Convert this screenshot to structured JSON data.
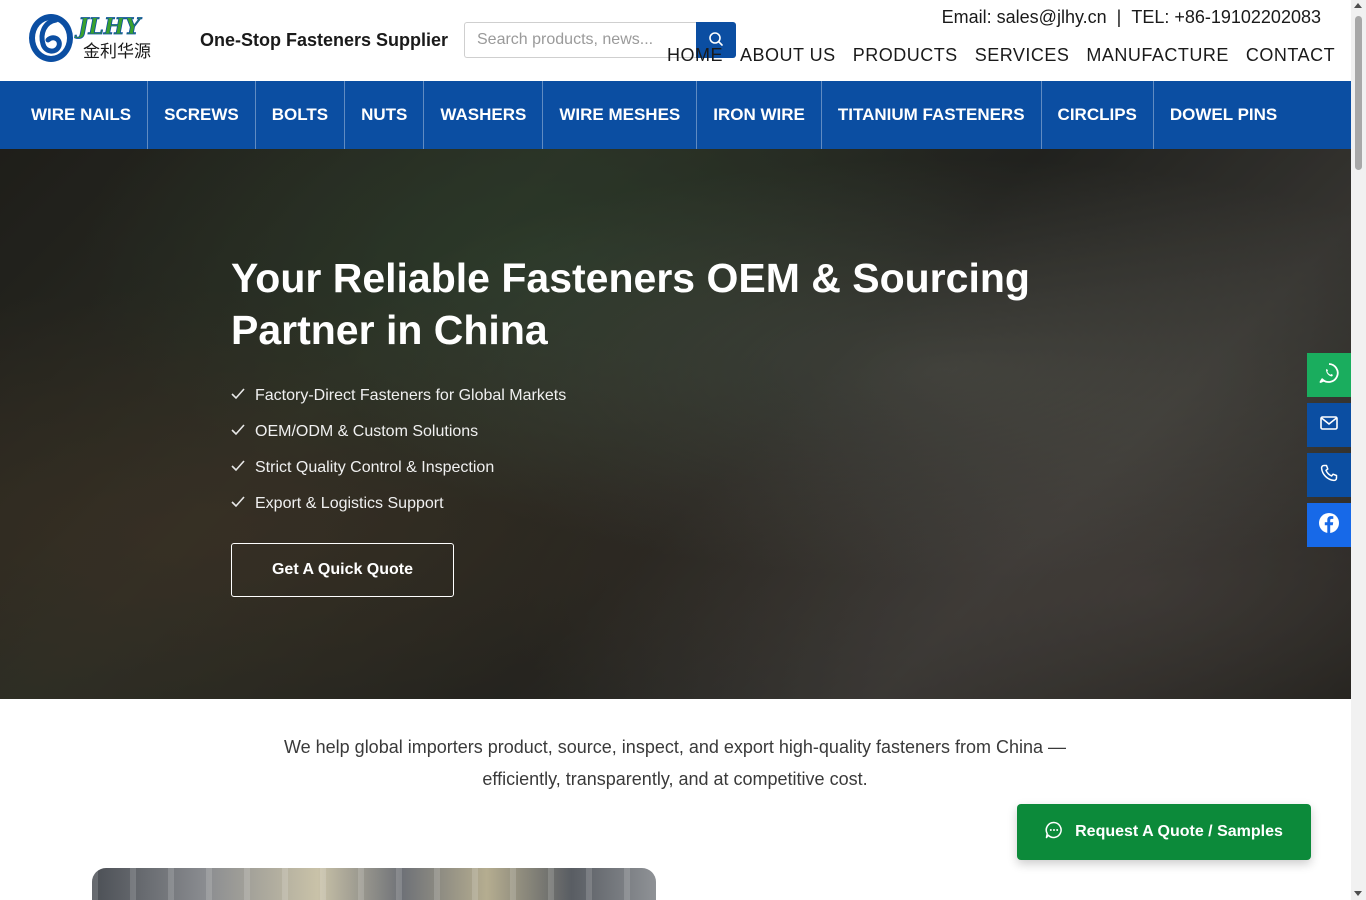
{
  "brand": {
    "logo_latin": "JLHY",
    "logo_chinese": "金利华源",
    "tagline": "One-Stop Fasteners Supplier",
    "primary_color": "#0b4ea2",
    "logo_green": "#3aa02e"
  },
  "search": {
    "placeholder": "Search products, news...",
    "button_icon": "search-icon"
  },
  "contact": {
    "email": "Email: sales@jlhy.cn",
    "separator": "|",
    "tel": "TEL: +86-19102202083"
  },
  "top_nav": [
    {
      "label": "HOME"
    },
    {
      "label": "ABOUT US"
    },
    {
      "label": "PRODUCTS"
    },
    {
      "label": "SERVICES"
    },
    {
      "label": "MANUFACTURE"
    },
    {
      "label": "CONTACT"
    }
  ],
  "categories": [
    {
      "label": "WIRE NAILS"
    },
    {
      "label": "SCREWS"
    },
    {
      "label": "BOLTS"
    },
    {
      "label": "NUTS"
    },
    {
      "label": "WASHERS"
    },
    {
      "label": "WIRE MESHES"
    },
    {
      "label": "IRON WIRE"
    },
    {
      "label": "TITANIUM FASTENERS"
    },
    {
      "label": "CIRCLIPS"
    },
    {
      "label": "DOWEL PINS"
    }
  ],
  "hero": {
    "title": "Your Reliable Fasteners OEM & Sourcing Partner in China",
    "features": [
      {
        "text": "Factory-Direct Fasteners for Global Markets",
        "icon": "check-icon"
      },
      {
        "text": "OEM/ODM & Custom Solutions",
        "icon": "check-icon"
      },
      {
        "text": "Strict Quality Control & Inspection",
        "icon": "check-icon"
      },
      {
        "text": "Export & Logistics Support",
        "icon": "check-icon"
      }
    ],
    "cta_label": "Get A Quick Quote"
  },
  "side_buttons": [
    {
      "icon": "whatsapp-icon",
      "color": "#1aad5e"
    },
    {
      "icon": "mail-icon",
      "color": "#0b4ea2"
    },
    {
      "icon": "phone-icon",
      "color": "#0b4ea2"
    },
    {
      "icon": "facebook-icon",
      "color": "#1769e8"
    }
  ],
  "intro": {
    "text": "We help global importers product, source, inspect, and export high-quality fasteners from China — efficiently, transparently, and at competitive cost."
  },
  "request_button": {
    "label": "Request A Quote / Samples",
    "icon": "chat-icon",
    "color": "#0c8a3a"
  }
}
